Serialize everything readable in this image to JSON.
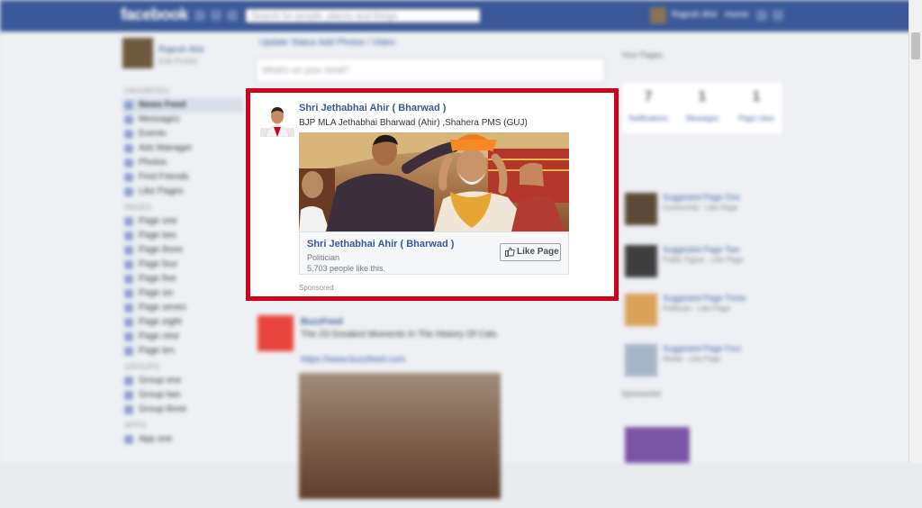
{
  "top_bar": {
    "logo": "facebook",
    "search_placeholder": "Search for people, places and things",
    "user_name": "Rajesh Ahir",
    "home_label": "Home"
  },
  "left_col": {
    "profile_name": "Rajesh Ahir",
    "edit_profile": "Edit Profile",
    "sections": [
      {
        "heading": "FAVORITES",
        "items": [
          "News Feed",
          "Messages",
          "Events",
          "Ads Manager",
          "Photos",
          "Find Friends",
          "Like Pages"
        ]
      },
      {
        "heading": "PAGES",
        "items": [
          "Page one",
          "Page two",
          "Page three",
          "Page four",
          "Page five",
          "Page six",
          "Page seven",
          "Page eight",
          "Page nine",
          "Page ten"
        ]
      },
      {
        "heading": "GROUPS",
        "items": [
          "Group one",
          "Group two",
          "Group three"
        ]
      },
      {
        "heading": "APPS",
        "items": [
          "App one"
        ]
      }
    ]
  },
  "center": {
    "composer_tabs": "Update Status   Add Photos / Video",
    "composer_placeholder": "What's on your mind?",
    "ad": {
      "page_name": "Shri Jethabhai Ahir ( Bharwad )",
      "description": "BJP MLA Jethabhai Bharwad (Ahir) ,Shahera PMS (GUJ)",
      "card_page_name": "Shri Jethabhai Ahir ( Bharwad )",
      "category": "Politician",
      "likes": "5,703 people like this.",
      "like_button": "Like Page",
      "sponsored": "Sponsored"
    },
    "next_post": {
      "name": "BuzzFeed",
      "text": "The 23 Greatest Moments In The History Of Cats",
      "link": "https://www.buzzfeed.com"
    }
  },
  "right_col": {
    "header": "Your Pages",
    "stats": [
      {
        "value": "7",
        "label": "Notifications"
      },
      {
        "value": "1",
        "label": "Messages"
      },
      {
        "value": "1",
        "label": "Page Likes"
      }
    ],
    "suggestions": [
      {
        "name": "Suggested Page One",
        "sub": "Community · Like Page"
      },
      {
        "name": "Suggested Page Two",
        "sub": "Public Figure · Like Page"
      },
      {
        "name": "Suggested Page Three",
        "sub": "Politician · Like Page"
      },
      {
        "name": "Suggested Page Four",
        "sub": "Media · Like Page"
      }
    ],
    "sponsored_header": "Sponsored"
  },
  "colors": {
    "brand_blue": "#3b5998",
    "highlight_red": "#d0021b"
  }
}
